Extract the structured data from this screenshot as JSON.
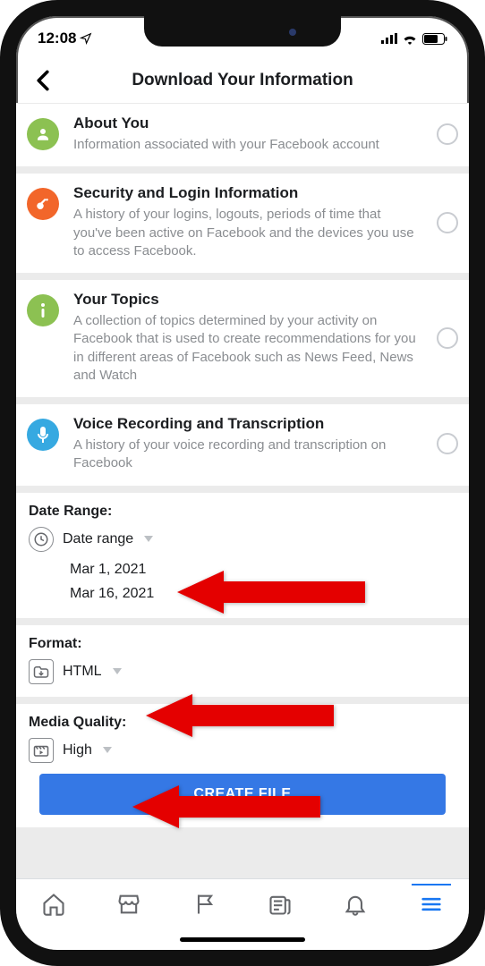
{
  "status": {
    "time": "12:08"
  },
  "header": {
    "title": "Download Your Information"
  },
  "items": [
    {
      "title": "About You",
      "subtitle": "Information associated with your Facebook account",
      "icon": "icon-about",
      "iconName": "profile-icon"
    },
    {
      "title": "Security and Login Information",
      "subtitle": "A history of your logins, logouts, periods of time that you've been active on Facebook and the devices you use to access Facebook.",
      "icon": "icon-sec",
      "iconName": "key-icon"
    },
    {
      "title": "Your Topics",
      "subtitle": "A collection of topics determined by your activity on Facebook that is used to create recommendations for you in different areas of Facebook such as News Feed, News and Watch",
      "icon": "icon-topics",
      "iconName": "info-icon"
    },
    {
      "title": "Voice Recording and Transcription",
      "subtitle": "A history of your voice recording and transcription on Facebook",
      "icon": "icon-voice",
      "iconName": "microphone-icon"
    }
  ],
  "dateRange": {
    "label": "Date Range:",
    "valueLabel": "Date range",
    "from": "Mar 1, 2021",
    "to": "Mar 16, 2021"
  },
  "format": {
    "label": "Format:",
    "value": "HTML"
  },
  "mediaQuality": {
    "label": "Media Quality:",
    "value": "High"
  },
  "createButton": "CREATE FILE",
  "colors": {
    "primary": "#3578e5",
    "tabActive": "#1877f2"
  }
}
